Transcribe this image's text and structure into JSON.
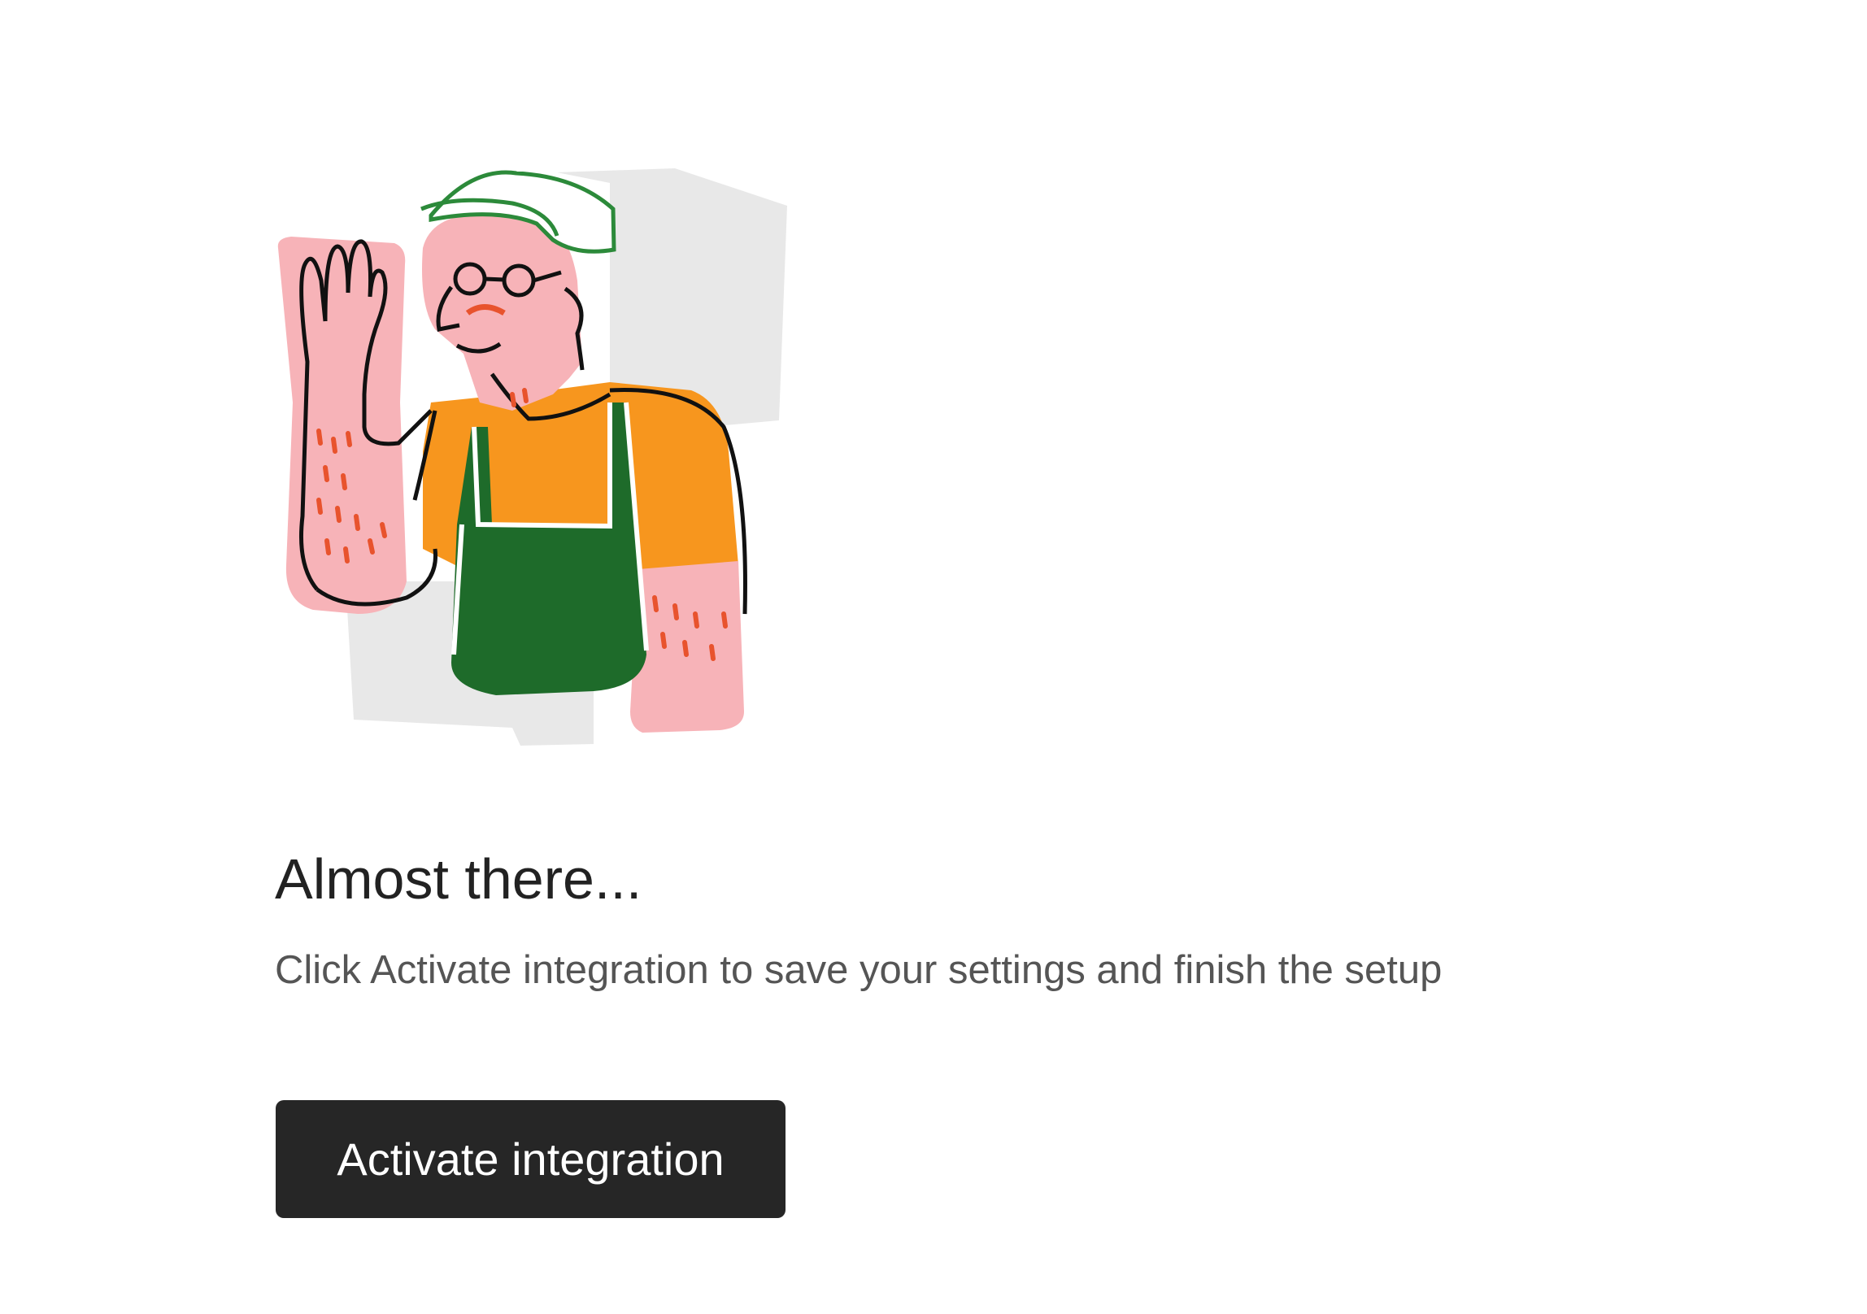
{
  "illustration": {
    "icon": "waving-person-illustration",
    "colors": {
      "background_shapes": "#e7e7e7",
      "skin": "#f7b3b8",
      "shirt": "#f7961e",
      "apron": "#1e6b2a",
      "cap": "#2c8a3a",
      "outline": "#111111",
      "accent": "#e8532d"
    }
  },
  "content": {
    "heading": "Almost there...",
    "description": "Click Activate integration to save your settings and finish the setup",
    "primary_button": "Activate integration"
  },
  "theme": {
    "button_background": "#262626",
    "button_text": "#ffffff",
    "heading_color": "#222222",
    "text_color": "#555555"
  }
}
